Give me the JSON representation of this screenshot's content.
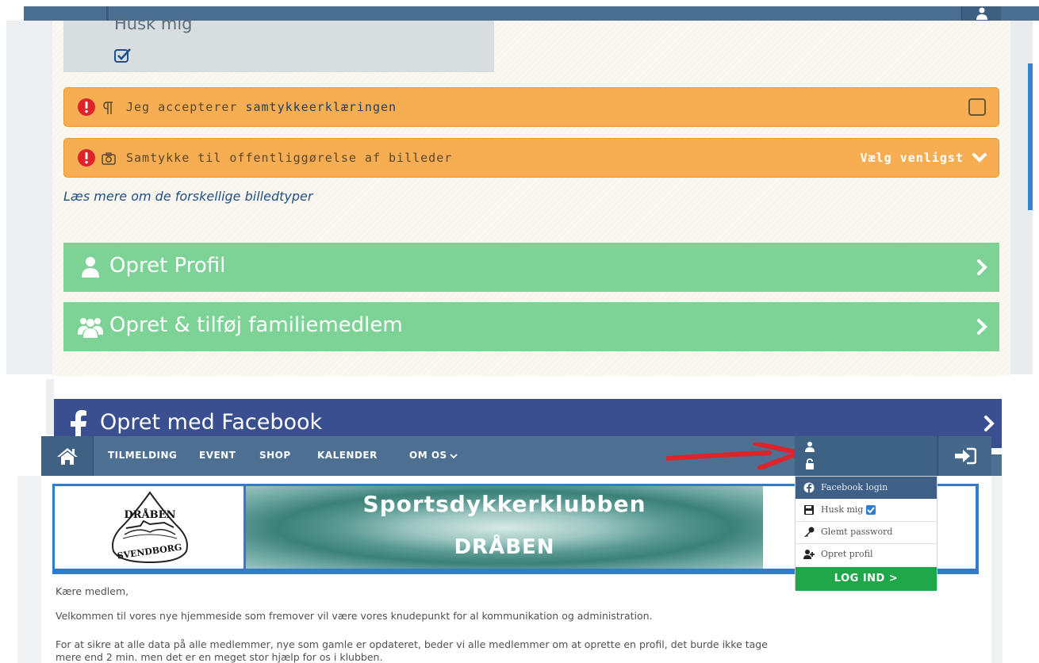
{
  "registration": {
    "remember_me_label": "Husk mig",
    "consent_prefix": "Jeg accepterer ",
    "consent_link": "samtykkeerklæringen",
    "photo_consent_label": "Samtykke til offentliggørelse af billeder",
    "photo_consent_select": "Vælg venligst",
    "read_more_link": "Læs mere om de forskellige billedtyper",
    "create_profile_button": "Opret Profil",
    "add_family_button": "Opret & tilføj familiemedlem",
    "facebook_button": "Opret med Facebook"
  },
  "site": {
    "nav": {
      "items": [
        "TILMELDING",
        "EVENT",
        "SHOP",
        "KALENDER",
        "OM OS"
      ]
    },
    "banner": {
      "title": "Sportsdykkerklubben",
      "subtitle": "DRÅBEN",
      "logo_top_text": "DRÅBEN",
      "logo_bottom_text": "SVENDBORG"
    },
    "login_dropdown": {
      "facebook_login": "Facebook login",
      "remember_me": "Husk mig",
      "forgot_password": "Glemt password",
      "create_profile": "Opret profil",
      "login_button": "LOG IND  >"
    },
    "content": {
      "greeting": "Kære medlem,",
      "paragraph1": "Velkommen til vores nye hjemmeside som fremover vil være vores knudepunkt for al kommunikation og administration.",
      "paragraph2_line1": "For at sikre at alle data på alle medlemmer, nye som gamle er opdateret, beder vi alle medlemmer om at oprette en profil, det burde ikke tage",
      "paragraph2_line2": "mere end 2 min. men det er en meget stor hjælp for os i klubben."
    }
  },
  "colors": {
    "nav_blue": "#4c6f92",
    "warning_orange": "#f7ae53",
    "action_green": "#7dd296",
    "facebook_blue": "#3a4f8f",
    "login_green": "#1fa74a",
    "annotation_red": "#e0232a"
  },
  "icons": {
    "alert": "exclamation-circle-icon",
    "paragraph": "pilcrow-icon",
    "camera": "camera-icon",
    "user": "user-icon",
    "users": "users-icon",
    "facebook": "facebook-icon",
    "home": "home-icon",
    "login": "sign-in-icon",
    "lock": "lock-icon",
    "key": "key-icon",
    "add_user": "user-plus-icon"
  }
}
